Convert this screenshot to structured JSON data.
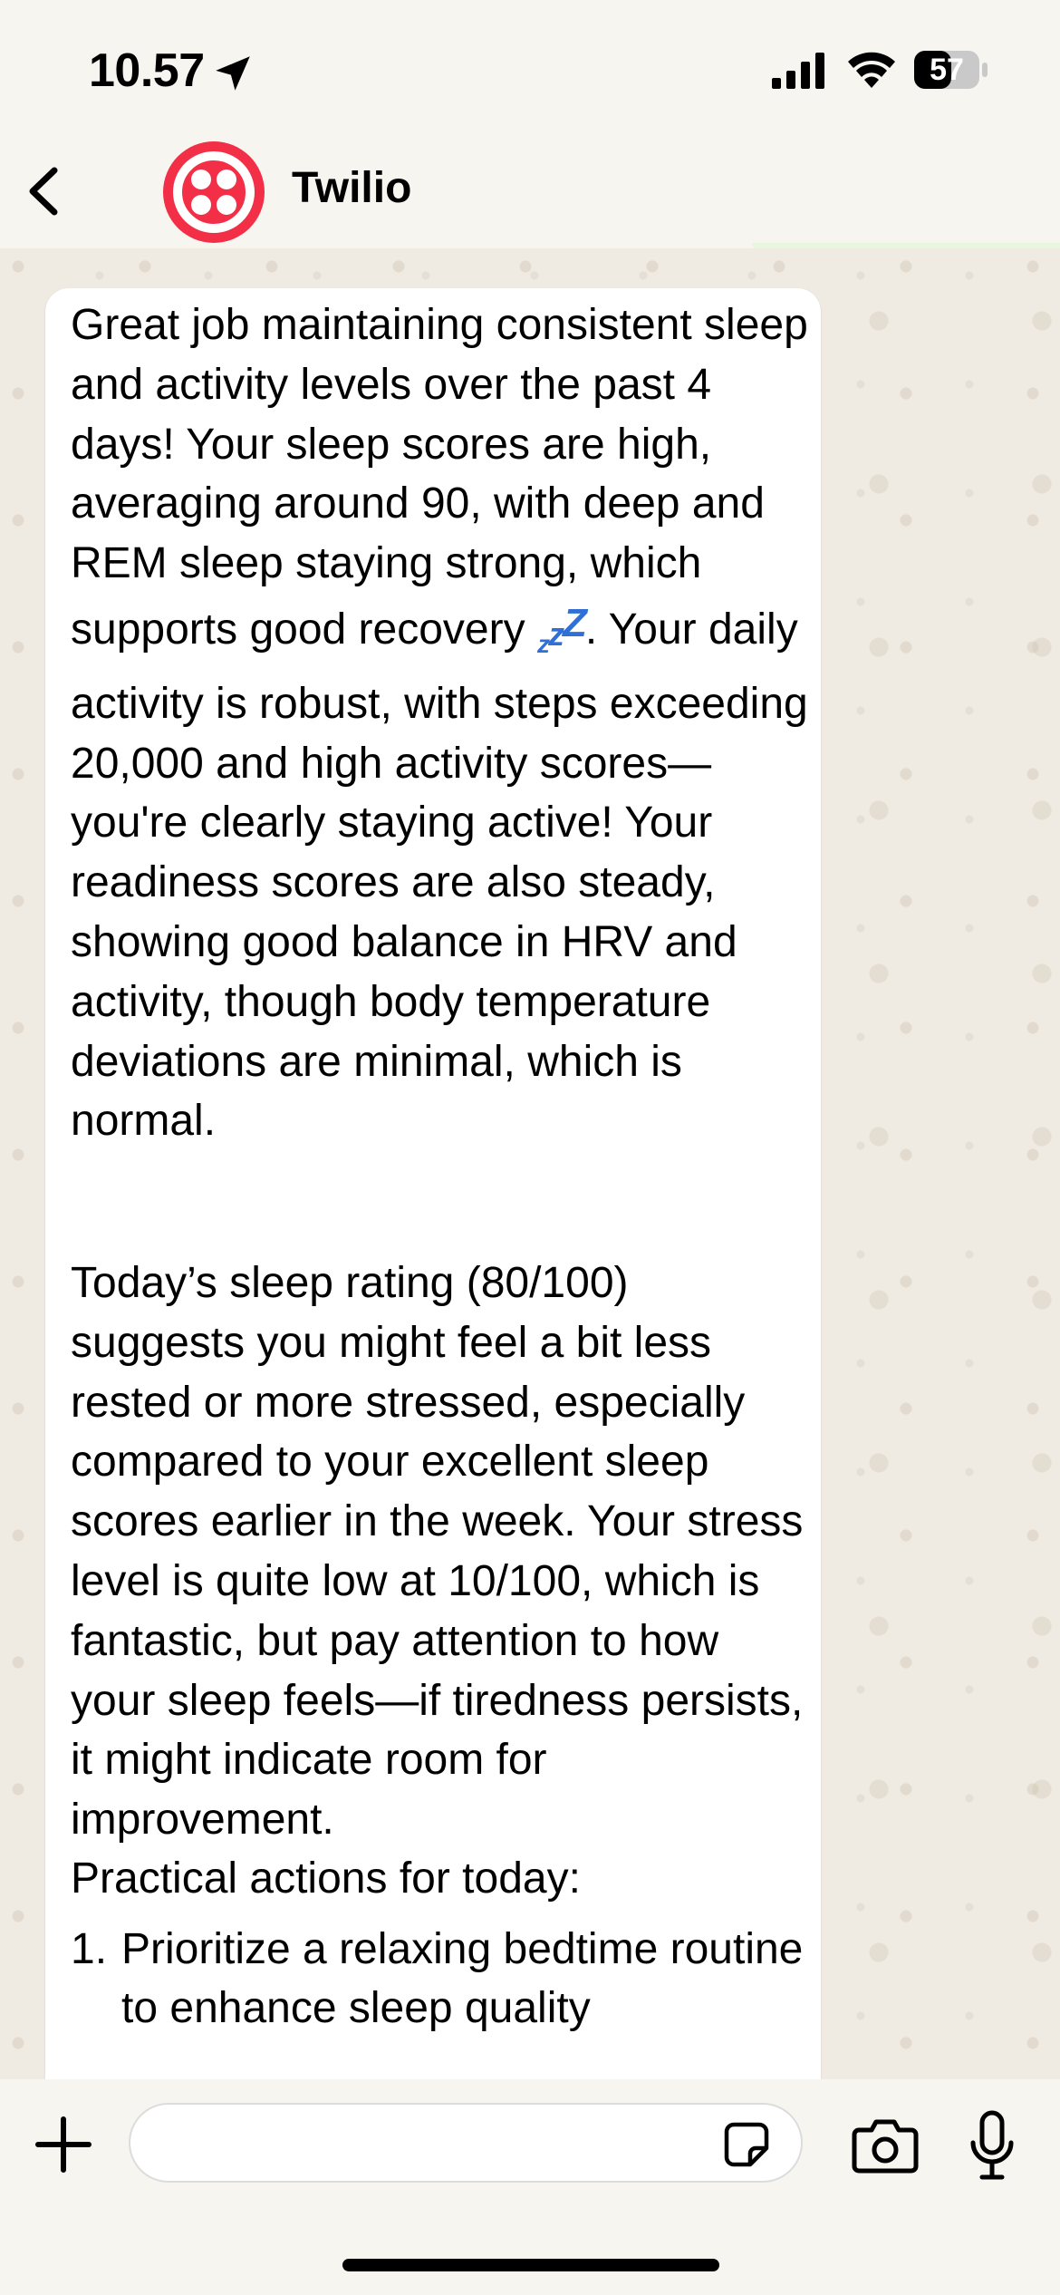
{
  "status_bar": {
    "time": "10.57",
    "battery": "57"
  },
  "header": {
    "contact_name": "Twilio"
  },
  "colors": {
    "avatar_bg": "#f22f46",
    "zzz_accent": "#2f6fd6",
    "bubble_bg": "#ffffff"
  },
  "icons": [
    "location-arrow-icon",
    "signal-icon",
    "wifi-icon",
    "battery-icon",
    "back-icon",
    "twilio-logo-icon",
    "plus-icon",
    "sticker-icon",
    "camera-icon",
    "microphone-icon"
  ],
  "message": {
    "para1_before": "Great job maintaining consistent sleep and activity levels over the past 4 days! Your sleep scores are high, averaging around 90, with deep and REM sleep staying strong, which supports good recovery ",
    "emoji_zzz": [
      "z",
      "z",
      "Z"
    ],
    "para1_after": ". Your daily activity is robust, with steps exceeding 20,000 and high activity scores—you're clearly staying active! Your readiness scores are also steady, showing good balance in HRV and activity, though body temperature deviations are minimal, which is normal.",
    "para2": "Today’s sleep rating (80/100) suggests you might feel a bit less rested or more stressed, especially compared to your excellent sleep scores earlier in the week. Your stress level is quite low at 10/100, which is fantastic, but pay attention to how your sleep feels—if tiredness persists, it might indicate room for improvement.",
    "para3": "Practical actions for today:",
    "list": [
      {
        "num": "1.",
        "text": "Prioritize a relaxing bedtime routine to enhance sleep quality"
      }
    ]
  },
  "input": {
    "value": "",
    "placeholder": ""
  }
}
